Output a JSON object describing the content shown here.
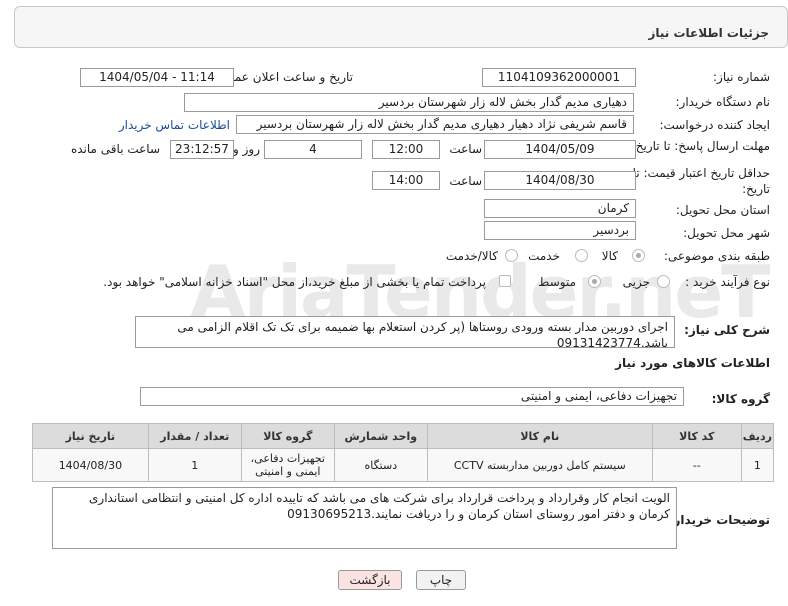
{
  "header": {
    "title": "جزئیات اطلاعات نیاز"
  },
  "watermark": "AriaTender.neT",
  "fields": {
    "need_number_label": "شماره نیاز:",
    "need_number": "1104109362000001",
    "announce_label": "تاریخ و ساعت اعلان عمومی:",
    "announce_value": "1404/05/04 - 11:14",
    "buyer_org_label": "نام دستگاه خریدار:",
    "buyer_org": "دهیاری مدیم گدار بخش لاله زار شهرستان بردسیر",
    "creator_label": "ایجاد کننده درخواست:",
    "creator": "قاسم شریفی نژاد دهیار دهیاری مدیم گدار بخش لاله زار شهرستان بردسیر",
    "contact_link": "اطلاعات تماس خریدار",
    "deadline_label": "مهلت ارسال پاسخ: تا تاریخ:",
    "deadline_date": "1404/05/09",
    "time_label": "ساعت",
    "deadline_time": "12:00",
    "days_value": "4",
    "days_label": "روز و",
    "remaining_time": "23:12:57",
    "remaining_label": "ساعت باقی مانده",
    "validity_label": "حداقل تاریخ اعتبار قیمت: تا تاریخ:",
    "validity_date": "1404/08/30",
    "validity_time": "14:00",
    "province_label": "استان محل تحویل:",
    "province": "کرمان",
    "city_label": "شهر محل تحویل:",
    "city": "بردسیر",
    "category_label": "طبقه بندی موضوعی:",
    "category_options": [
      "کالا",
      "خدمت",
      "کالا/خدمت"
    ],
    "purchase_type_label": "نوع فرآیند خرید :",
    "purchase_options": [
      "جزیی",
      "متوسط"
    ],
    "payment_note": "پرداخت تمام یا بخشی از مبلغ خرید،از محل \"اسناد خزانه اسلامی\" خواهد بود.",
    "description_label": "شرح کلی نیاز:",
    "description": "اجرای دوربین مدار بسته ورودی روستاها (پر کردن استعلام بها ضمیمه برای تک تک اقلام الزامی می باشد.09131423774"
  },
  "goods": {
    "section_title": "اطلاعات کالاهای مورد نیاز",
    "group_label": "گروه کالا:",
    "group_value": "تجهیزات دفاعی، ایمنی و امنیتی",
    "columns": [
      "ردیف",
      "کد کالا",
      "نام کالا",
      "واحد شمارش",
      "گروه کالا",
      "تعداد / مقدار",
      "تاریخ نیاز"
    ],
    "rows": [
      [
        "1",
        "--",
        "سیستم کامل دوربین مداربسته CCTV",
        "دستگاه",
        "تجهیزات دفاعی، ایمنی و امنیتی",
        "1",
        "1404/08/30"
      ]
    ]
  },
  "buyer_notes": {
    "label": "توضیحات خریدار:",
    "text": "الویت انجام کار وقرارداد و پرداخت قرارداد برای شرکت های می باشد که تاییده اداره کل  امنیتی و انتظامی استانداری کرمان و دفتر امور روستای استان کرمان و را دریافت نمایند.09130695213"
  },
  "buttons": {
    "print": "چاپ",
    "back": "بازگشت"
  }
}
